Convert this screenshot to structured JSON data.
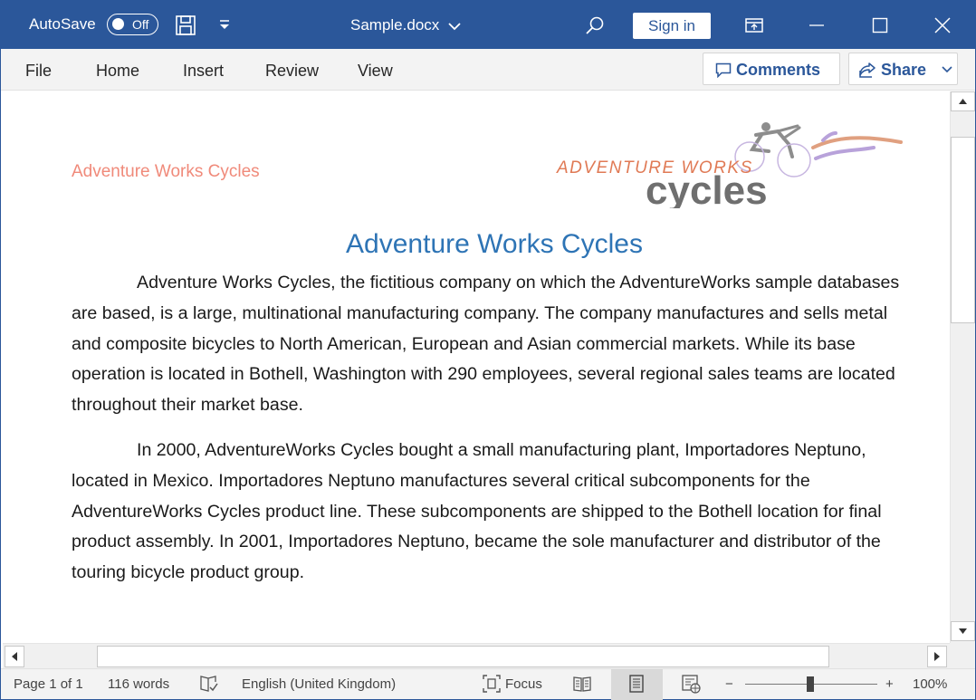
{
  "titlebar": {
    "autosave_label": "AutoSave",
    "autosave_state": "Off",
    "document_title": "Sample.docx",
    "signin_label": "Sign in",
    "background_color": "#2b579a"
  },
  "menubar": {
    "items": [
      "File",
      "Home",
      "Insert",
      "Review",
      "View"
    ],
    "comments_label": "Comments",
    "share_label": "Share"
  },
  "document": {
    "header_text": "Adventure Works Cycles",
    "logo_line1": "ADVENTURE WORKS",
    "logo_line2": "cycles",
    "title": "Adventure Works Cycles",
    "paragraphs": [
      "Adventure Works Cycles, the fictitious company on which the AdventureWorks sample databases are based, is a large, multinational manufacturing company. The company manufactures and sells metal and composite bicycles to North American, European and Asian commercial markets. While its base operation is located in Bothell, Washington with 290 employees, several regional sales teams are located throughout their market base.",
      "In 2000, AdventureWorks Cycles bought a small manufacturing plant, Importadores Neptuno, located in Mexico. Importadores Neptuno manufactures several critical subcomponents for the AdventureWorks Cycles product line. These subcomponents are shipped to the Bothell location for final product assembly. In 2001, Importadores Neptuno, became the sole manufacturer and distributor of the touring bicycle product group."
    ],
    "header_color": "#f08a7a",
    "title_color": "#2e74b5"
  },
  "statusbar": {
    "page": "Page 1 of 1",
    "words": "116 words",
    "language": "English (United Kingdom)",
    "focus_label": "Focus",
    "zoom_minus": "−",
    "zoom_plus": "+",
    "zoom": "100%"
  }
}
